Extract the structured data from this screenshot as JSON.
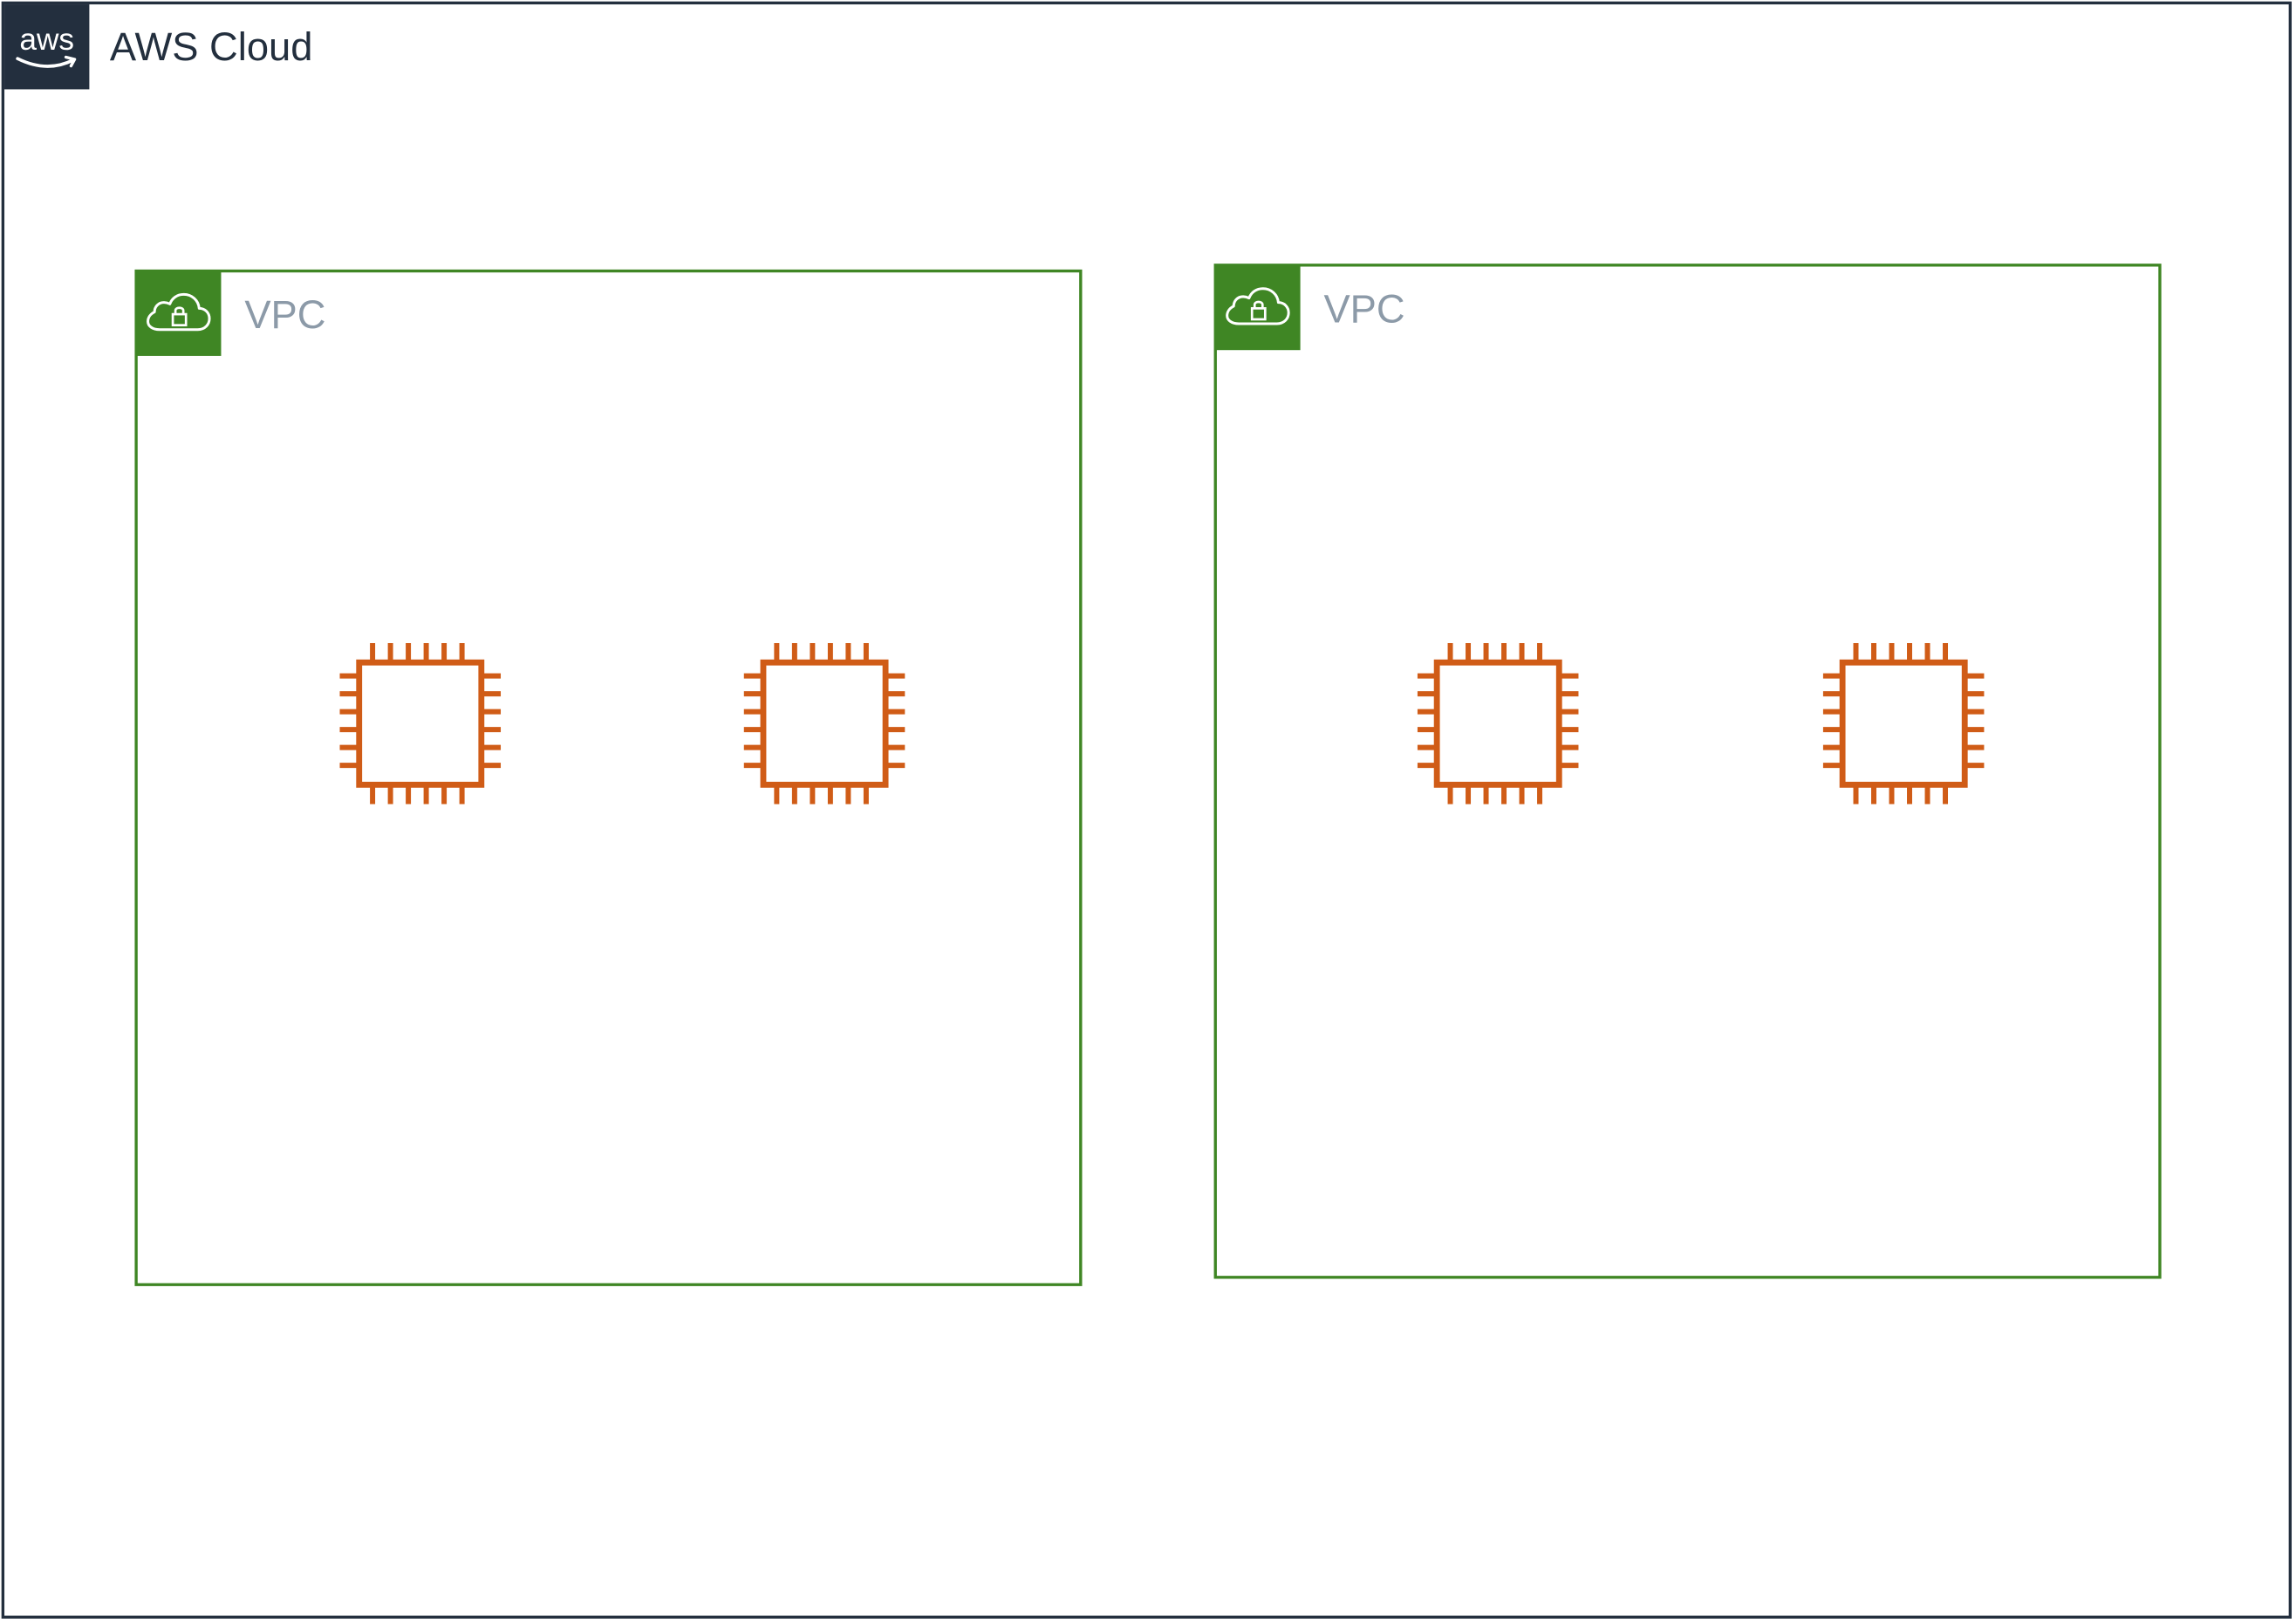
{
  "colors": {
    "cloud_border": "#232f3e",
    "vpc_border": "#3f8624",
    "instance_icon": "#d05c17",
    "vpc_label_text": "#8c9aa8"
  },
  "cloud": {
    "badge_icon": "aws-logo-icon",
    "badge_text": "aws",
    "title": "AWS Cloud"
  },
  "vpcs": [
    {
      "badge_icon": "vpc-cloud-lock-icon",
      "label": "VPC",
      "instances": [
        {
          "icon": "ec2-instance-icon"
        },
        {
          "icon": "ec2-instance-icon"
        }
      ]
    },
    {
      "badge_icon": "vpc-cloud-lock-icon",
      "label": "VPC",
      "instances": [
        {
          "icon": "ec2-instance-icon"
        },
        {
          "icon": "ec2-instance-icon"
        }
      ]
    }
  ]
}
